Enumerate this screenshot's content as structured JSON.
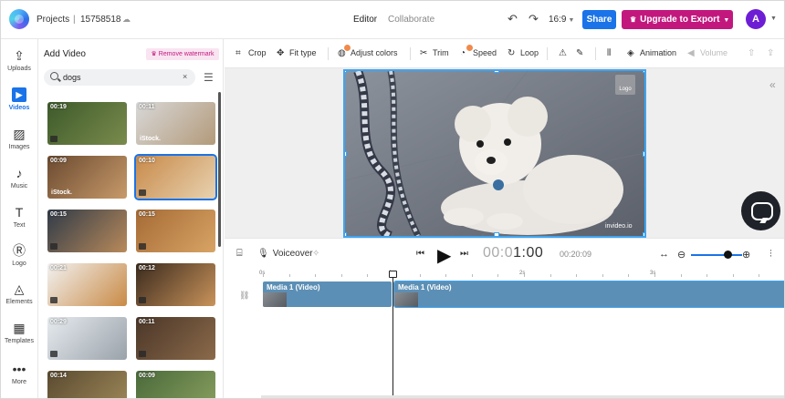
{
  "topbar": {
    "breadcrumb_projects": "Projects",
    "breadcrumb_sep": "|",
    "project_id": "15758518",
    "tab_editor": "Editor",
    "tab_collaborate": "Collaborate",
    "aspect_ratio": "16:9",
    "share_label": "Share",
    "upgrade_label": "Upgrade to Export",
    "avatar_initial": "A"
  },
  "leftnav": [
    {
      "label": "Uploads",
      "icon": "upload-icon",
      "glyph": "⇪",
      "active": false
    },
    {
      "label": "Videos",
      "icon": "video-icon",
      "glyph": "▶",
      "active": true
    },
    {
      "label": "Images",
      "icon": "image-icon",
      "glyph": "▨",
      "active": false
    },
    {
      "label": "Music",
      "icon": "music-icon",
      "glyph": "♪",
      "active": false
    },
    {
      "label": "Text",
      "icon": "text-icon",
      "glyph": "T",
      "active": false
    },
    {
      "label": "Logo",
      "icon": "logo-icon",
      "glyph": "Ⓡ",
      "active": false
    },
    {
      "label": "Elements",
      "icon": "elements-icon",
      "glyph": "◬",
      "active": false
    },
    {
      "label": "Templates",
      "icon": "templates-icon",
      "glyph": "▦",
      "active": false
    },
    {
      "label": "More",
      "icon": "more-icon",
      "glyph": "•••",
      "active": false
    }
  ],
  "panel": {
    "title": "Add Video",
    "watermark_label": "♛ Remove watermark",
    "search_value": "dogs",
    "thumbnails": [
      {
        "duration": "00:19",
        "istock": "",
        "colors": [
          "#3d5a2a",
          "#7a8b4d"
        ],
        "selected": false
      },
      {
        "duration": "00:11",
        "istock": "iStock.",
        "colors": [
          "#d8d8d8",
          "#b39a7a"
        ],
        "selected": false
      },
      {
        "duration": "00:09",
        "istock": "iStock.",
        "colors": [
          "#6b4a30",
          "#c79a6a"
        ],
        "selected": false
      },
      {
        "duration": "00:10",
        "istock": "",
        "colors": [
          "#c88a4a",
          "#e8d2b0"
        ],
        "selected": true
      },
      {
        "duration": "00:15",
        "istock": "",
        "colors": [
          "#2f3a48",
          "#b98a5a"
        ],
        "selected": false
      },
      {
        "duration": "00:15",
        "istock": "",
        "colors": [
          "#a56a35",
          "#d8a465"
        ],
        "selected": false
      },
      {
        "duration": "00:21",
        "istock": "",
        "colors": [
          "#f2f2f2",
          "#c98a45"
        ],
        "selected": false
      },
      {
        "duration": "00:12",
        "istock": "",
        "colors": [
          "#3a2a1e",
          "#c9935a"
        ],
        "selected": false
      },
      {
        "duration": "00:29",
        "istock": "",
        "colors": [
          "#e6ebef",
          "#9aa2aa"
        ],
        "selected": false
      },
      {
        "duration": "00:11",
        "istock": "",
        "colors": [
          "#4a3628",
          "#8b6a4a"
        ],
        "selected": false
      },
      {
        "duration": "00:14",
        "istock": "",
        "colors": [
          "#5a4a30",
          "#a08a5a"
        ],
        "selected": false
      },
      {
        "duration": "00:09",
        "istock": "",
        "colors": [
          "#4a6a3a",
          "#8aa060"
        ],
        "selected": false
      }
    ]
  },
  "toolbar": {
    "crop": "Crop",
    "fit_type": "Fit type",
    "adjust_colors": "Adjust colors",
    "trim": "Trim",
    "speed": "Speed",
    "loop": "Loop",
    "animation": "Animation",
    "volume": "Volume"
  },
  "canvas": {
    "logo_tag": "Logo",
    "watermark_text": "invideo.io"
  },
  "playback": {
    "voiceover_label": "Voiceover",
    "current_time_dim": "00:0",
    "current_time_main": "1:00",
    "total_time": "00:20:09"
  },
  "timeline": {
    "ruler": [
      "0s",
      "1s",
      "2s",
      "3s"
    ],
    "clips": [
      {
        "label": "Media 1 (Video)"
      },
      {
        "label": "Media 1 (Video)"
      }
    ]
  },
  "colors": {
    "accent_blue": "#1a73e8",
    "upgrade_magenta": "#c2187e",
    "avatar_purple": "#6d1ed4",
    "clip_blue": "#5c8fb5"
  }
}
